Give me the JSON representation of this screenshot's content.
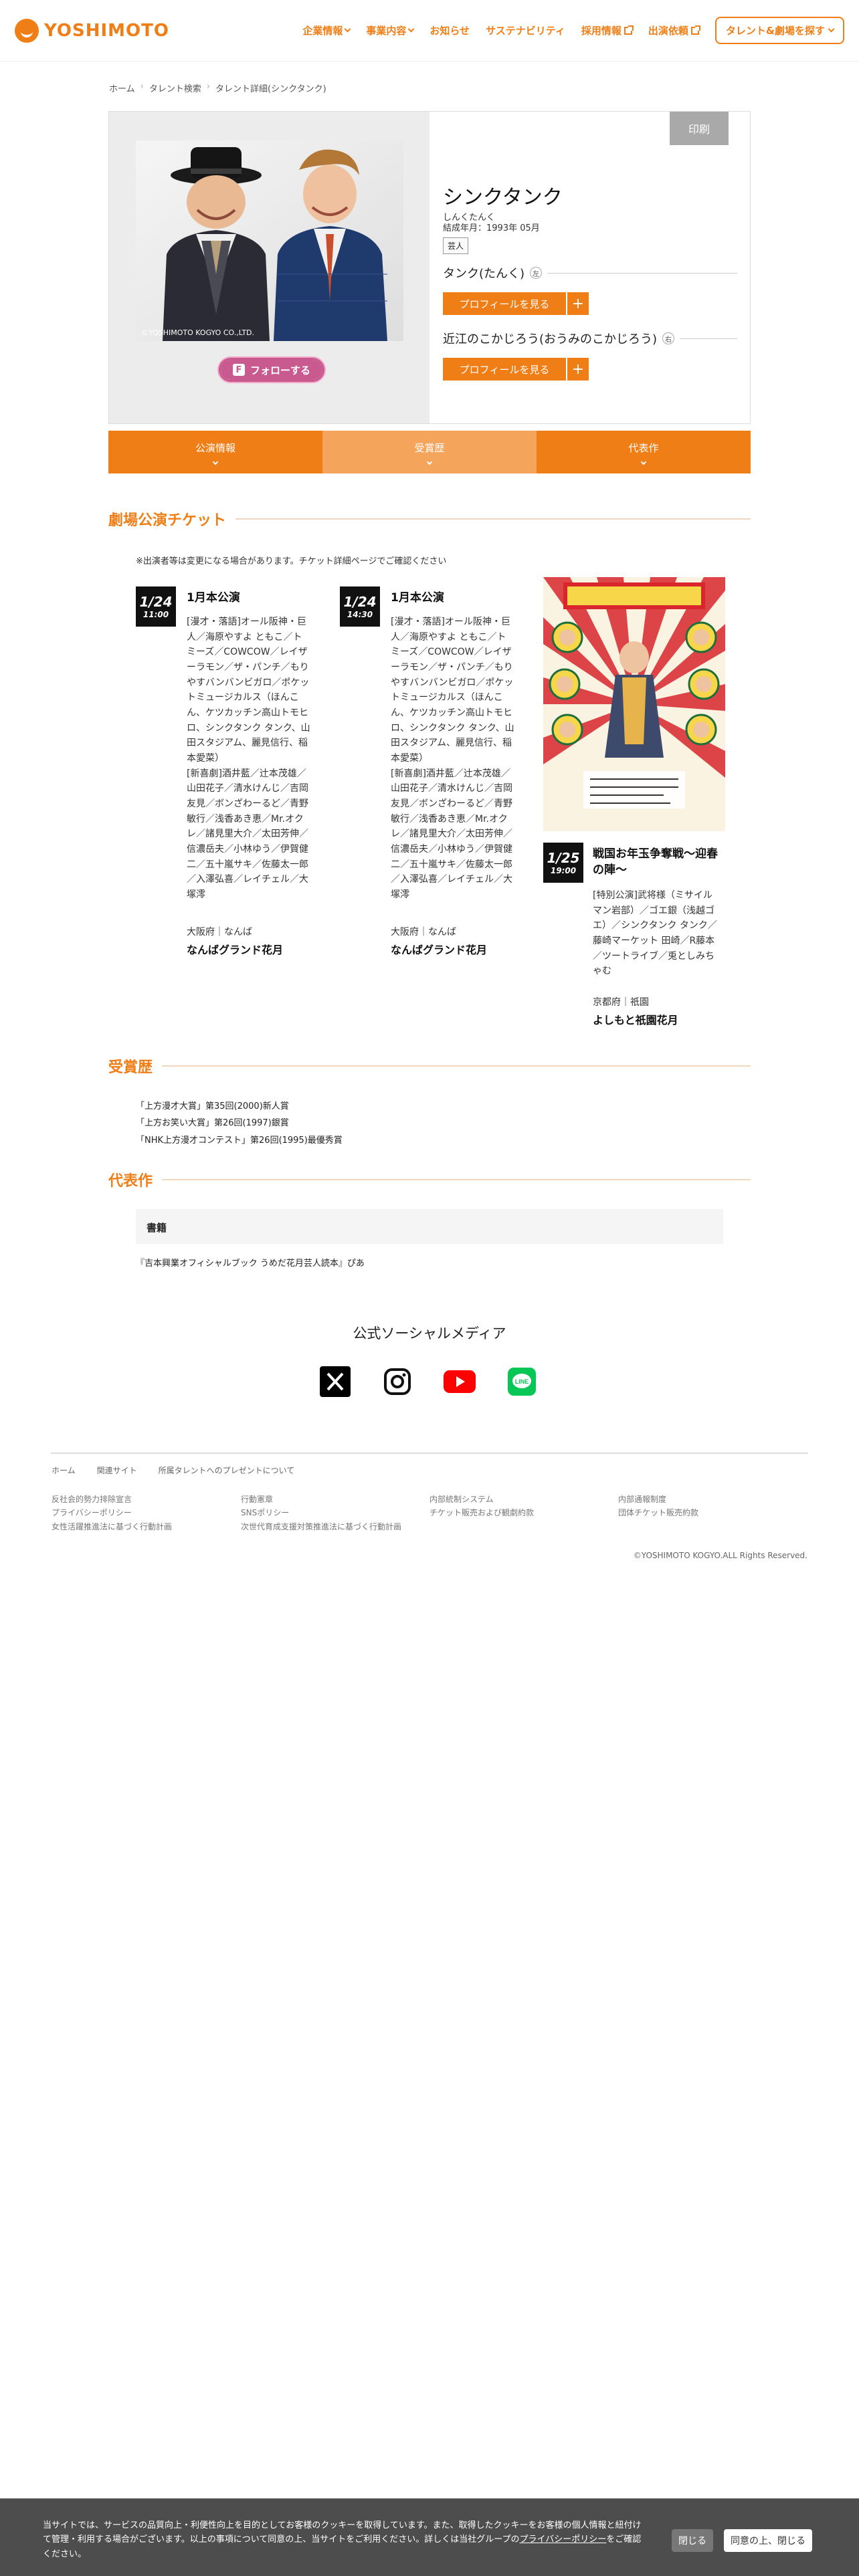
{
  "header": {
    "logo_text": "YOSHIMOTO",
    "nav": [
      {
        "label": "企業情報",
        "kind": "dropdown"
      },
      {
        "label": "事業内容",
        "kind": "dropdown"
      },
      {
        "label": "お知らせ",
        "kind": "link"
      },
      {
        "label": "サステナビリティ",
        "kind": "link"
      },
      {
        "label": "採用情報",
        "kind": "external"
      },
      {
        "label": "出演依頼",
        "kind": "external"
      }
    ],
    "search_button": "タレント&劇場を探す"
  },
  "breadcrumb": [
    "ホーム",
    "タレント検索",
    "タレント詳細(シンクタンク)"
  ],
  "profile": {
    "print_label": "印刷",
    "name": "シンクタンク",
    "kana": "しんくたんく",
    "formed": "結成年月：1993年 05月",
    "tag": "芸人",
    "photo_copyright": "©YOSHIMOTO KOGYO CO.,LTD.",
    "follow_label": "フォローする",
    "members": [
      {
        "name": "タンク(たんく)",
        "position": "左",
        "button": "プロフィールを見る"
      },
      {
        "name": "近江のこかじろう(おうみのこかじろう)",
        "position": "右",
        "button": "プロフィールを見る"
      }
    ]
  },
  "tabs": [
    {
      "label": "公演情報",
      "active": false
    },
    {
      "label": "受賞歴",
      "active": true
    },
    {
      "label": "代表作",
      "active": false
    }
  ],
  "tickets": {
    "heading": "劇場公演チケット",
    "note": "※出演者等は変更になる場合があります。チケット詳細ページでご確認ください",
    "events": [
      {
        "date": "1/24",
        "time": "11:00",
        "title": "1月本公演",
        "desc": "[漫才・落語]オール阪神・巨人／海原やすよ ともこ／トミーズ／COWCOW／レイザーラモン／ザ・パンチ／もりやすバンバンビガロ／ポケットミュージカルス（ほんこん、ケツカッチン高山トモヒロ、シンクタンク タンク、山田スタジアム、麗見信行、稲本愛菜）\n[新喜劇]酒井藍／辻本茂雄／山田花子／清水けんじ／吉岡友見／ボンざわーるど／青野敏行／浅香あき恵／Mr.オクレ／諸見里大介／太田芳伸／信濃岳夫／小林ゆう／伊賀健二／五十嵐サキ／佐藤太一郎／入澤弘喜／レイチェル／大塚澪",
        "pref": "大阪府｜なんば",
        "venue": "なんばグランド花月"
      },
      {
        "date": "1/24",
        "time": "14:30",
        "title": "1月本公演",
        "desc": "[漫才・落語]オール阪神・巨人／海原やすよ ともこ／トミーズ／COWCOW／レイザーラモン／ザ・パンチ／もりやすバンバンビガロ／ポケットミュージカルス（ほんこん、ケツカッチン高山トモヒロ、シンクタンク タンク、山田スタジアム、麗見信行、稲本愛菜）\n[新喜劇]酒井藍／辻本茂雄／山田花子／清水けんじ／吉岡友見／ボンざわーるど／青野敏行／浅香あき恵／Mr.オクレ／諸見里大介／太田芳伸／信濃岳夫／小林ゆう／伊賀健二／五十嵐サキ／佐藤太一郎／入澤弘喜／レイチェル／大塚澪",
        "pref": "大阪府｜なんば",
        "venue": "なんばグランド花月"
      },
      {
        "date": "1/25",
        "time": "19:00",
        "title": "戦国お年玉争奪戦〜迎春の陣〜",
        "desc": "[特別公演]武将様（ミサイルマン岩部）／ゴエ銀（浅越ゴエ）／シンクタンク タンク／藤崎マーケット 田崎／R藤本／ツートライブ／兎としみちゃむ",
        "pref": "京都府｜祇園",
        "venue": "よしもと祇園花月"
      }
    ]
  },
  "awards": {
    "heading": "受賞歴",
    "items": [
      "「上方漫才大賞」第35回(2000)新人賞",
      "「上方お笑い大賞」第26回(1997)銀賞",
      "「NHK上方漫才コンテスト」第26回(1995)最優秀賞"
    ]
  },
  "works": {
    "heading": "代表作",
    "category": "書籍",
    "items": [
      "『吉本興業オフィシャルブック うめだ花月芸人読本』ぴあ"
    ]
  },
  "social": {
    "title": "公式ソーシャルメディア",
    "icons": [
      "x-icon",
      "instagram-icon",
      "youtube-icon",
      "line-icon"
    ]
  },
  "footer": {
    "nav": [
      "ホーム",
      "関連サイト",
      "所属タレントへのプレゼントについて"
    ],
    "col1": [
      "反社会的勢力排除宣言",
      "プライバシーポリシー",
      "女性活躍推進法に基づく行動計画"
    ],
    "col2": [
      "行動憲章",
      "SNSポリシー",
      "次世代育成支援対策推進法に基づく行動計画"
    ],
    "col3": [
      "内部統制システム",
      "チケット販売および観劇約款"
    ],
    "col4": [
      "内部通報制度",
      "団体チケット販売約款"
    ],
    "copyright": "©YOSHIMOTO KOGYO.ALL Rights Reserved."
  },
  "cookie": {
    "text_before": "当サイトでは、サービスの品質向上・利便性向上を目的としてお客様のクッキーを取得しています。また、取得したクッキーをお客様の個人情報と紐付けて管理・利用する場合がございます。以上の事項について同意の上、当サイトをご利用ください。詳しくは当社グループの",
    "link": "プライバシーポリシー",
    "text_after": "をご確認ください。",
    "close": "閉じる",
    "agree": "同意の上、閉じる"
  },
  "colors": {
    "brand": "#f07e16",
    "follow": "#c95a8f",
    "cookie_bg": "#4d4d4d"
  }
}
